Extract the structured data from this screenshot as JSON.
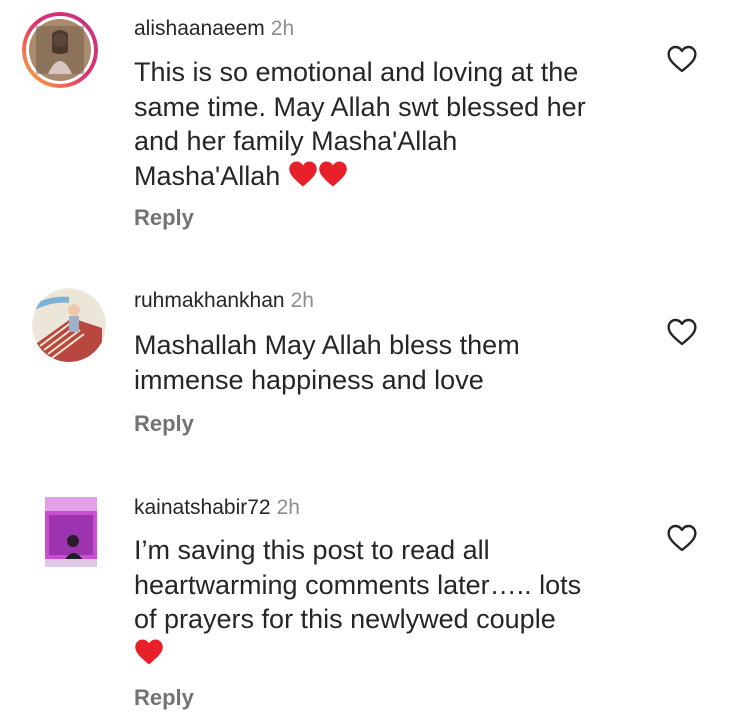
{
  "comments": [
    {
      "username": "alishaanaeem",
      "time": "2h",
      "lines": [
        "This is so emotional and loving at the",
        "same time. May Allah swt blessed her",
        "and her family Masha'Allah",
        "Masha'Allah"
      ],
      "hearts": 2,
      "reply_label": "Reply"
    },
    {
      "username": "ruhmakhankhan",
      "time": "2h",
      "lines": [
        "Mashallah May Allah bless them",
        "immense happiness and love"
      ],
      "hearts": 0,
      "reply_label": "Reply"
    },
    {
      "username": "kainatshabir72",
      "time": "2h",
      "lines": [
        "I’m saving this post to read all",
        "heartwarming comments later….. lots",
        "of prayers for this newlywed couple"
      ],
      "hearts": 1,
      "reply_label": "Reply"
    }
  ],
  "icons": {
    "like": "heart-outline-icon",
    "emoji": "red-heart-emoji"
  },
  "colors": {
    "username": "#262626",
    "meta": "#8e8e8e",
    "reply": "#737373",
    "heart_emoji": "#e8202a"
  }
}
